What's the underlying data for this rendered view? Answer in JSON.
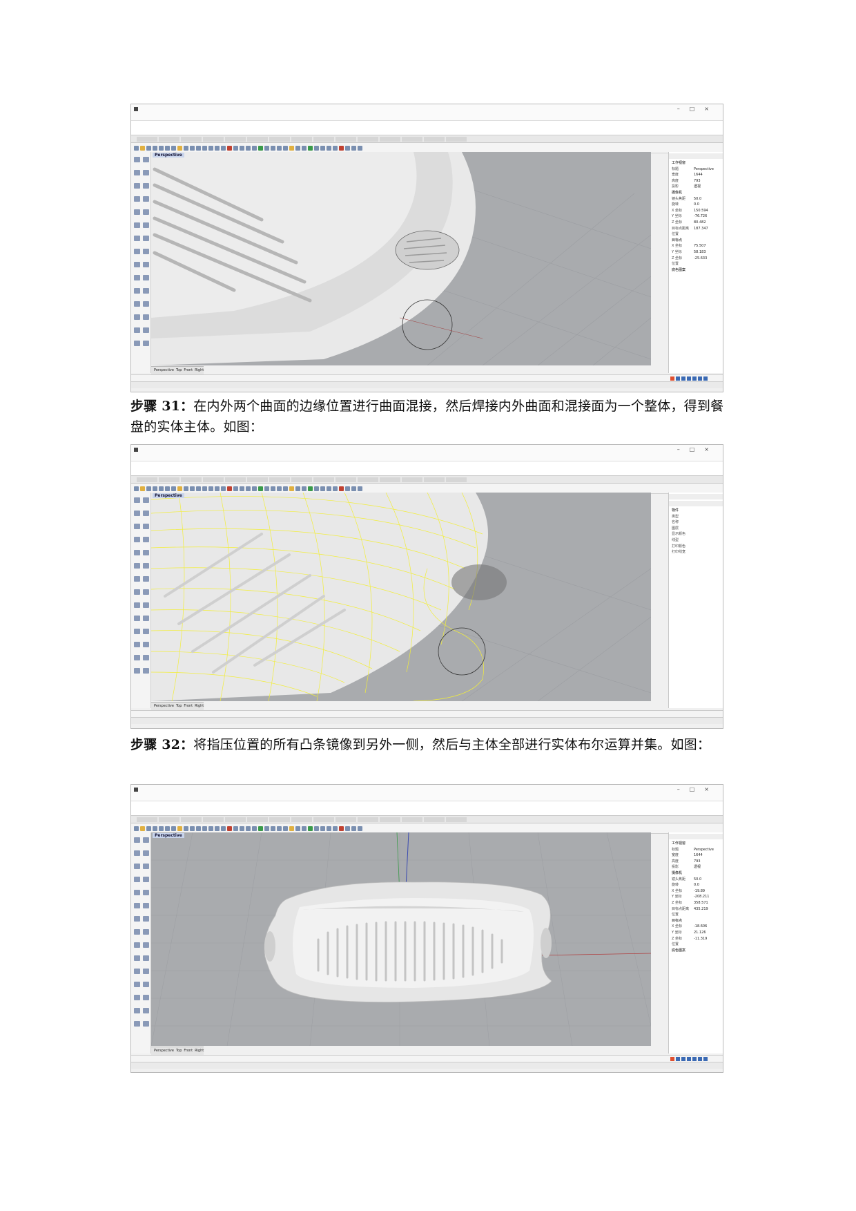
{
  "screenshots": [
    {
      "window_title": "",
      "command_lines": [
        "",
        ""
      ],
      "viewport_label": "Perspective",
      "view_tabs": [
        "Perspective",
        "Top",
        "Front",
        "Right"
      ],
      "panel": {
        "section_view": "工作视窗",
        "rows": [
          [
            "标题",
            "Perspective"
          ],
          [
            "宽度",
            "1644"
          ],
          [
            "高度",
            "793"
          ],
          [
            "投影",
            "透视"
          ]
        ],
        "section_camera": "摄像机",
        "camera": [
          [
            "镜头焦距",
            "50.0"
          ],
          [
            "旋转",
            "0.0"
          ],
          [
            "X 坐标",
            "150.594"
          ],
          [
            "Y 坐标",
            "-76.726"
          ],
          [
            "Z 坐标",
            "80.482"
          ],
          [
            "目标点距离",
            "187.347"
          ],
          [
            "位置",
            ""
          ]
        ],
        "section_target": "目标点",
        "target": [
          [
            "X 坐标",
            "75.507"
          ],
          [
            "Y 坐标",
            "58.183"
          ],
          [
            "Z 坐标",
            "-25.633"
          ],
          [
            "位置",
            ""
          ]
        ],
        "section_bg": "底色图案"
      },
      "status_coords": ""
    },
    {
      "window_title": "",
      "command_lines": [
        "",
        ""
      ],
      "viewport_label": "Perspective",
      "view_tabs": [
        "Perspective",
        "Top",
        "Front",
        "Right"
      ],
      "panel": {
        "section_view": "物件",
        "rows": [
          [
            "类型",
            ""
          ],
          [
            "名称",
            ""
          ],
          [
            "图层",
            ""
          ],
          [
            "显示颜色",
            ""
          ],
          [
            "线型",
            ""
          ],
          [
            "打印颜色",
            ""
          ],
          [
            "打印线宽",
            ""
          ]
        ],
        "section_camera": "",
        "camera": [],
        "section_target": "",
        "target": [],
        "section_bg": ""
      },
      "status_coords": ""
    },
    {
      "window_title": "",
      "command_lines": [
        "",
        ""
      ],
      "viewport_label": "Perspective",
      "view_tabs": [
        "Perspective",
        "Top",
        "Front",
        "Right"
      ],
      "panel": {
        "section_view": "工作视窗",
        "rows": [
          [
            "标题",
            "Perspective"
          ],
          [
            "宽度",
            "1644"
          ],
          [
            "高度",
            "793"
          ],
          [
            "投影",
            "透视"
          ]
        ],
        "section_camera": "摄像机",
        "camera": [
          [
            "镜头焦距",
            "50.0"
          ],
          [
            "旋转",
            "0.0"
          ],
          [
            "X 坐标",
            "-19.89"
          ],
          [
            "Y 坐标",
            "-208.211"
          ],
          [
            "Z 坐标",
            "358.571"
          ],
          [
            "目标点距离",
            "435.219"
          ],
          [
            "位置",
            ""
          ]
        ],
        "section_target": "目标点",
        "target": [
          [
            "X 坐标",
            "-18.606"
          ],
          [
            "Y 坐标",
            "21.126"
          ],
          [
            "Z 坐标",
            "-11.319"
          ],
          [
            "位置",
            ""
          ]
        ],
        "section_bg": "底色图案"
      },
      "status_coords": ""
    }
  ],
  "captions": [
    {
      "step": "步骤 31：",
      "text": "在内外两个曲面的边缘位置进行曲面混接，然后焊接内外曲面和混接面为一个整体，得到餐盘的实体主体。如图："
    },
    {
      "step": "步骤 32：",
      "text": "将指压位置的所有凸条镜像到另外一侧，然后与主体全部进行实体布尔运算并集。如图："
    }
  ],
  "colors": {
    "viewport_bg": "#a9abae",
    "selection_wire": "#f2ee3a",
    "surface": "#eeeeee"
  }
}
